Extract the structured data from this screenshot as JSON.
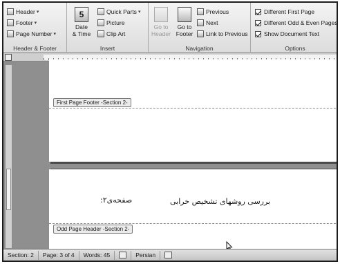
{
  "ribbon": {
    "header_footer": {
      "header": "Header",
      "footer": "Footer",
      "page_number": "Page Number",
      "label": "Header & Footer"
    },
    "insert": {
      "date_time_line1": "Date",
      "date_time_line2": "& Time",
      "quick_parts": "Quick Parts",
      "picture": "Picture",
      "clip_art": "Clip Art",
      "label": "Insert"
    },
    "navigation": {
      "go_to_header_line1": "Go to",
      "go_to_header_line2": "Header",
      "go_to_footer_line1": "Go to",
      "go_to_footer_line2": "Footer",
      "previous": "Previous",
      "next": "Next",
      "link_to_previous": "Link to Previous",
      "label": "Navigation"
    },
    "options": {
      "different_first_page": "Different First Page",
      "different_odd_even": "Different Odd & Even Pages",
      "show_document_text": "Show Document Text",
      "label": "Options"
    }
  },
  "document": {
    "first_page_footer_tab": "First Page Footer -Section 2-",
    "odd_page_header_tab": "Odd Page Header -Section 2-",
    "header_title": "بررسی روشهای تشخیص خرابی",
    "header_page": "صفحه‌ی۲:"
  },
  "status_bar": {
    "section": "Section: 2",
    "page": "Page: 3 of 4",
    "words": "Words: 45",
    "language": "Persian"
  }
}
